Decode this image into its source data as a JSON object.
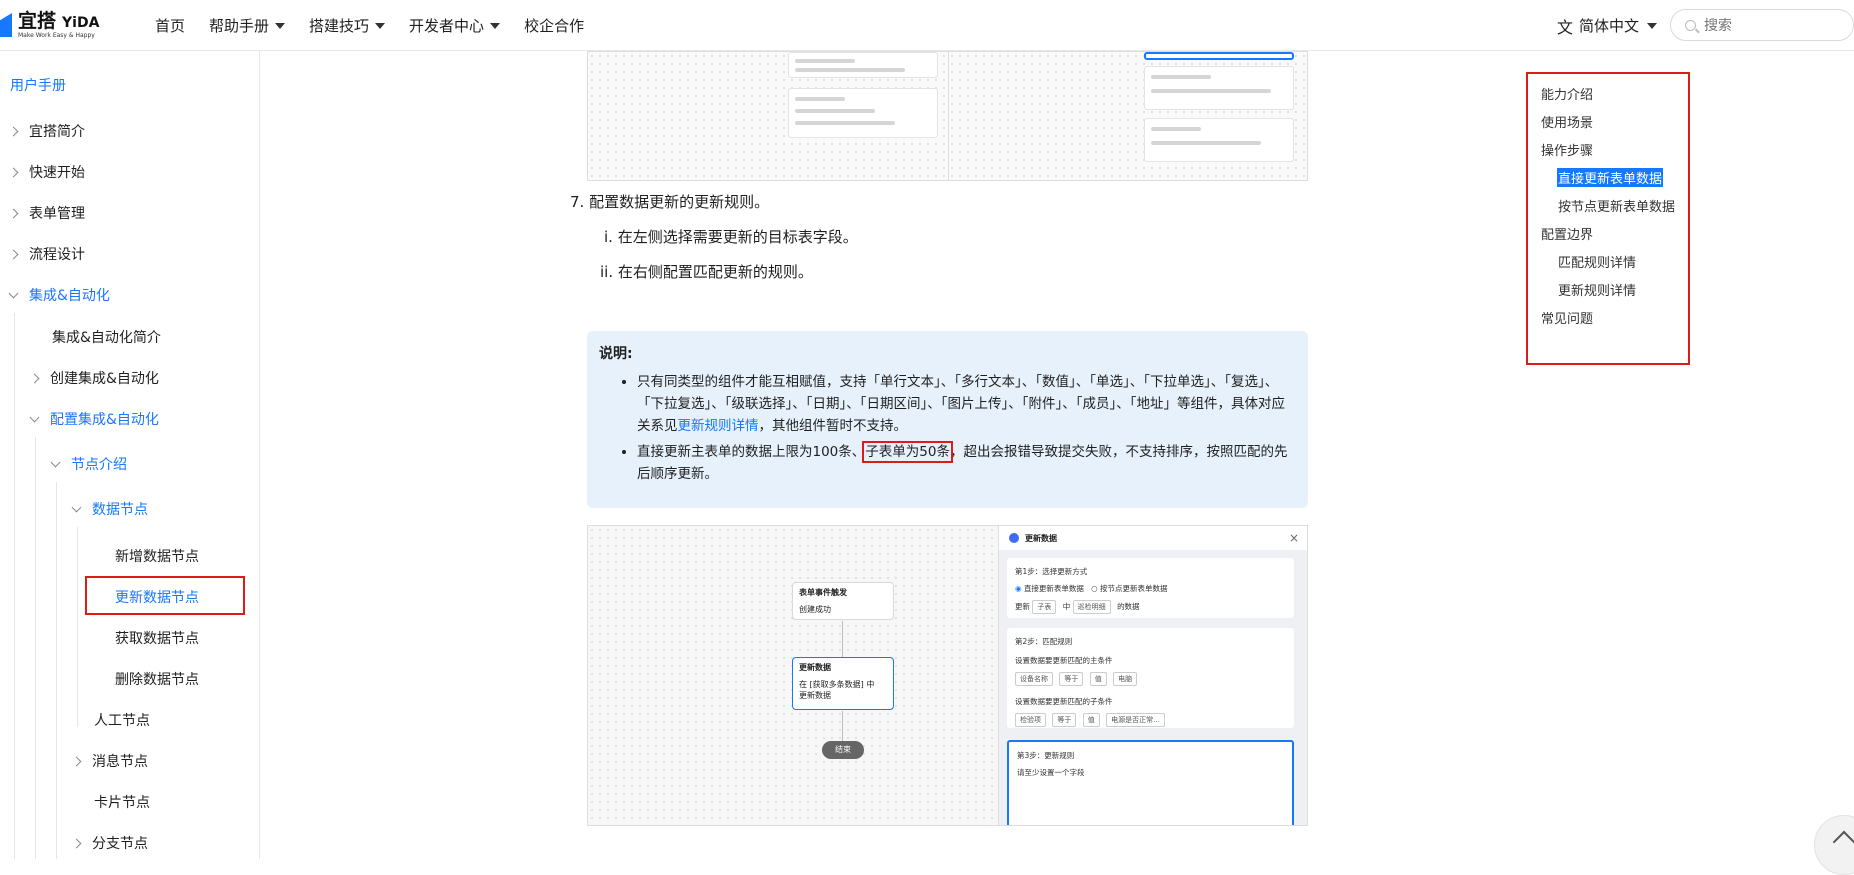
{
  "header": {
    "logo_title": "宜搭",
    "logo_brand": "YiDA",
    "logo_sub": "Make Work Easy & Happy",
    "nav": [
      {
        "label": "首页",
        "has_caret": false
      },
      {
        "label": "帮助手册",
        "has_caret": true
      },
      {
        "label": "搭建技巧",
        "has_caret": true
      },
      {
        "label": "开发者中心",
        "has_caret": true
      },
      {
        "label": "校企合作",
        "has_caret": false
      }
    ],
    "language": "简体中文",
    "search_placeholder": "搜索"
  },
  "sidebar": {
    "title": "用户手册",
    "items": [
      {
        "label": "宜搭简介"
      },
      {
        "label": "快速开始"
      },
      {
        "label": "表单管理"
      },
      {
        "label": "流程设计"
      },
      {
        "label": "集成&自动化"
      },
      {
        "label": "集成&自动化简介"
      },
      {
        "label": "创建集成&自动化"
      },
      {
        "label": "配置集成&自动化"
      },
      {
        "label": "节点介绍"
      },
      {
        "label": "数据节点"
      },
      {
        "label": "新增数据节点"
      },
      {
        "label": "更新数据节点"
      },
      {
        "label": "获取数据节点"
      },
      {
        "label": "删除数据节点"
      },
      {
        "label": "人工节点"
      },
      {
        "label": "消息节点"
      },
      {
        "label": "卡片节点"
      },
      {
        "label": "分支节点"
      }
    ]
  },
  "content": {
    "step7": "7. 配置数据更新的更新规则。",
    "sub_i": "i. 在左侧选择需要更新的目标表字段。",
    "sub_ii": "ii. 在右侧配置匹配更新的规则。",
    "note": {
      "title": "说明:",
      "bullet1_a": "只有同类型的组件才能互相赋值，支持「单行文本」、「多行文本」、「数值」、「单选」、「下拉单选」、「复选」、「下拉复选」、「级联选择」、「日期」、「日期区间」、「图片上传」、「附件」、「成员」、「地址」等组件，具体对应关系见",
      "bullet1_link": "更新规则详情",
      "bullet1_b": "，其他组件暂时不支持。",
      "bullet2_a": "直接更新主表单的数据上限为100条、",
      "bullet2_hl": "子表单为50条",
      "bullet2_b": "，超出会报错导致提交失败，不支持排序，按照匹配的先后顺序更新。"
    },
    "screenshot2": {
      "trigger_node_title": "表单事件触发",
      "trigger_node_body": "创建成功",
      "update_node_title": "更新数据",
      "update_node_body": "在 [获取多条数据] 中更新数据",
      "end_label": "结束",
      "panel_title": "更新数据",
      "step1_title": "第1步：选择更新方式",
      "step1_opt1": "直接更新表单数据",
      "step1_opt2": "按节点更新表单数据",
      "step1_row_a": "更新",
      "step1_row_b": "子表",
      "step1_row_c": "中",
      "step1_row_d": "巡检明细",
      "step1_row_e": "的数据",
      "step2_title": "第2步：匹配规则",
      "step2_main_label": "设置数据要更新匹配的主条件",
      "step2_main_row": [
        "设备名称",
        "等于",
        "值",
        "电脑"
      ],
      "step2_sub_label": "设置数据要更新匹配的子条件",
      "step2_sub_row": [
        "检验项",
        "等于",
        "值",
        "电源是否正常..."
      ],
      "step3_title": "第3步：更新规则",
      "step3_hint": "请至少设置一个字段"
    }
  },
  "toc": {
    "items": [
      {
        "label": "能力介绍",
        "level": 1
      },
      {
        "label": "使用场景",
        "level": 1
      },
      {
        "label": "操作步骤",
        "level": 1
      },
      {
        "label": "直接更新表单数据",
        "level": 2,
        "active": true
      },
      {
        "label": "按节点更新表单数据",
        "level": 2
      },
      {
        "label": "配置边界",
        "level": 1
      },
      {
        "label": "匹配规则详情",
        "level": 2
      },
      {
        "label": "更新规则详情",
        "level": 2
      },
      {
        "label": "常见问题",
        "level": 1
      }
    ]
  },
  "colors": {
    "accent": "#1677ff",
    "highlight_border": "#e01919",
    "note_bg": "#e6f1fc"
  }
}
